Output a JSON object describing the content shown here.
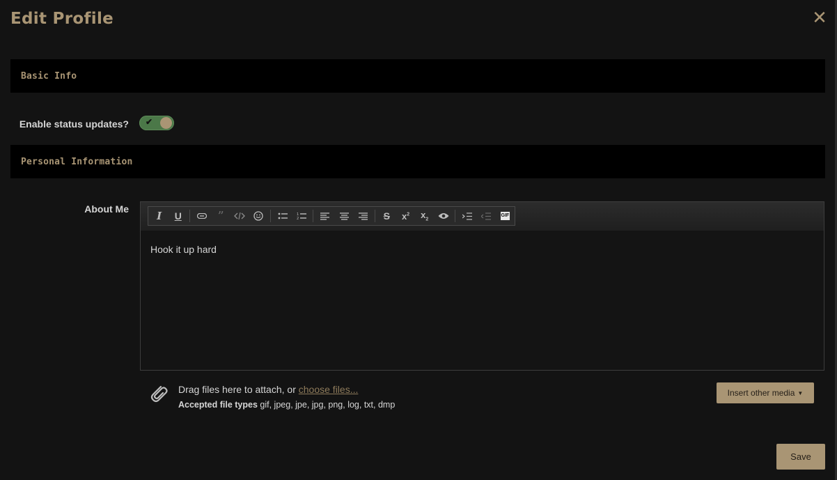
{
  "dialog": {
    "title": "Edit Profile",
    "close_icon": "close-icon"
  },
  "sections": {
    "basic_info": "Basic Info",
    "personal_info": "Personal Information"
  },
  "status_updates": {
    "label": "Enable status updates?",
    "enabled": true
  },
  "about_me": {
    "label": "About Me",
    "value": "Hook it up hard",
    "toolbar": [
      "italic-icon",
      "underline-icon",
      "link-icon",
      "quote-icon",
      "code-icon",
      "smilie-icon",
      "bullet-list-icon",
      "numbered-list-icon",
      "align-left-icon",
      "align-center-icon",
      "align-right-icon",
      "strikethrough-icon",
      "superscript-icon",
      "subscript-icon",
      "preview-icon",
      "indent-icon",
      "outdent-icon",
      "gif-icon"
    ],
    "gif_label": "GIF"
  },
  "attachments": {
    "drag_text": "Drag files here to attach, or ",
    "choose_link": "choose files...",
    "accepted_label": "Accepted file types",
    "accepted_types": " gif, jpeg, jpe, jpg, png, log, txt, dmp",
    "insert_media_label": "Insert other media"
  },
  "actions": {
    "save_label": "Save"
  },
  "colors": {
    "accent": "#a99574",
    "background": "#131313",
    "section_bg": "#000000",
    "toggle_on": "#4b7848"
  }
}
